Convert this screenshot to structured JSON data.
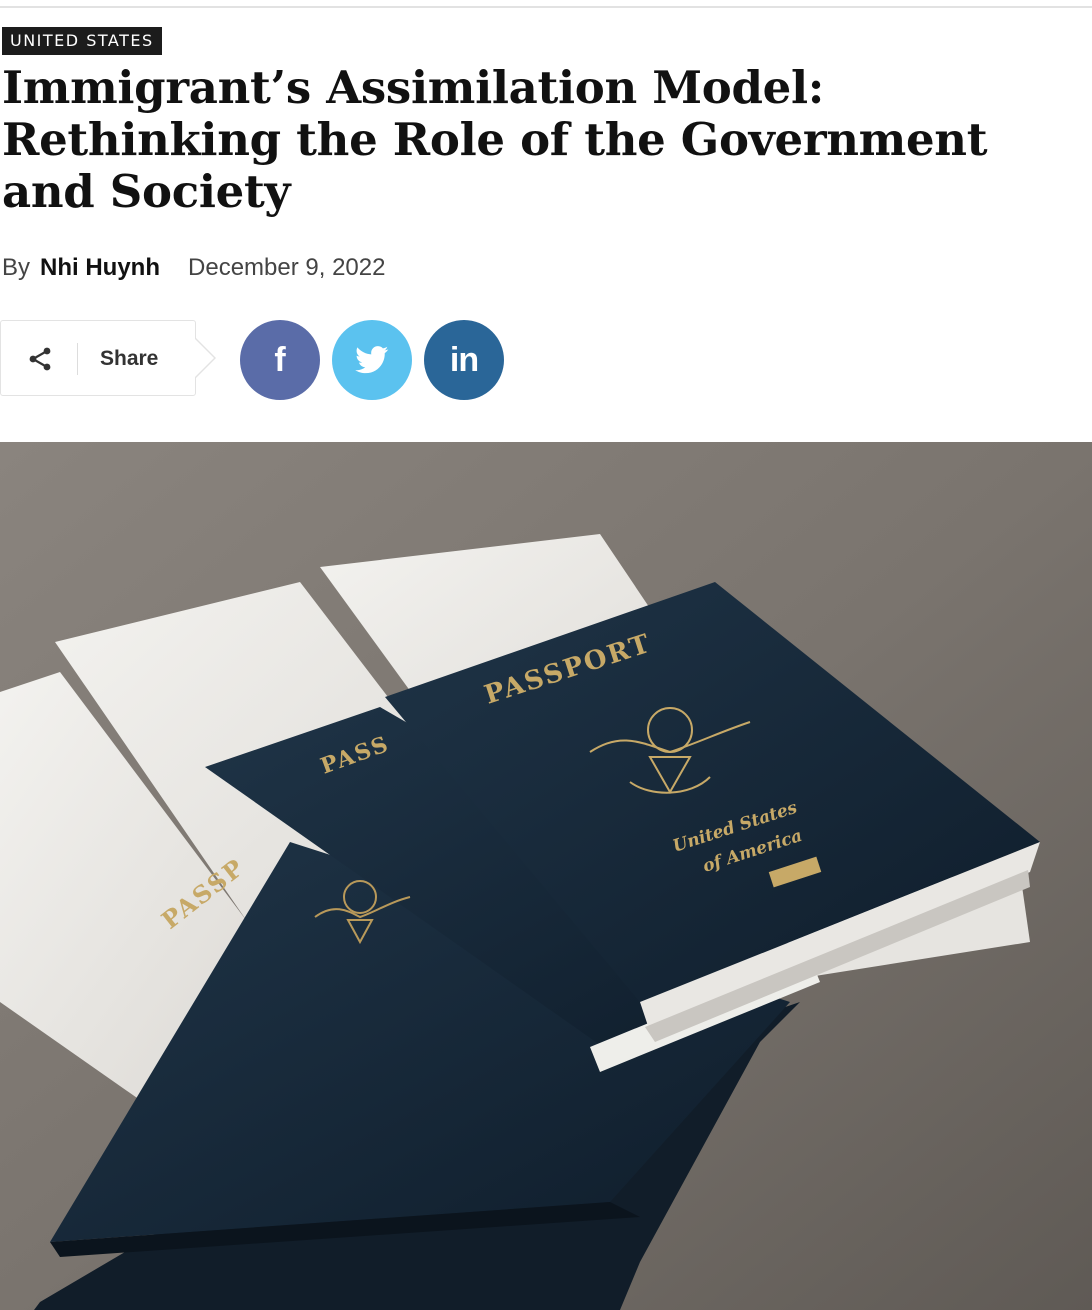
{
  "article": {
    "category": "UNITED STATES",
    "title": "Immigrant’s Assimilation Model: Rethinking the Role of the Government and Society",
    "byline_prefix": "By",
    "author": "Nhi Huynh",
    "date": "December 9, 2022"
  },
  "share": {
    "label": "Share",
    "icon": "share-icon",
    "buttons": [
      {
        "name": "facebook",
        "glyph": "f",
        "icon": "facebook-icon",
        "color": "#5a6ca8"
      },
      {
        "name": "twitter",
        "glyph": "",
        "icon": "twitter-bird-icon",
        "color": "#5bc2ef"
      },
      {
        "name": "linkedin",
        "glyph": "in",
        "icon": "linkedin-icon",
        "color": "#2a6698"
      }
    ]
  },
  "hero_image": {
    "passport_cover_text": "PASSPORT",
    "country_line1": "United States",
    "country_line2": "of America",
    "partial_cover_text_1": "PASSP",
    "partial_cover_text_2": "PASS"
  }
}
